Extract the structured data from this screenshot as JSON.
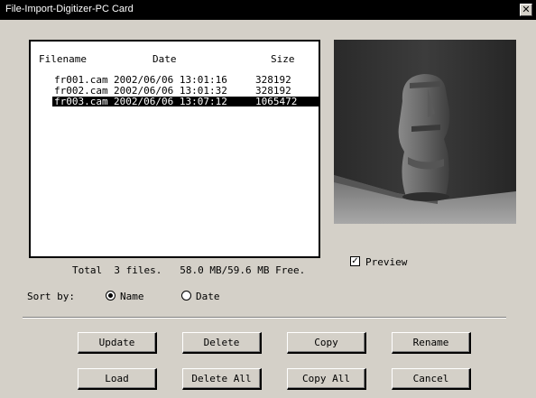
{
  "window": {
    "title": "File-Import-Digitizer-PC Card",
    "close_glyph": "✕"
  },
  "file_list": {
    "columns": [
      "Filename",
      "Date",
      "Size"
    ],
    "rows": [
      {
        "filename": "fr001.cam",
        "date": "2002/06/06 13:01:16",
        "size": "328192",
        "selected": false
      },
      {
        "filename": "fr002.cam",
        "date": "2002/06/06 13:01:32",
        "size": "328192",
        "selected": false
      },
      {
        "filename": "fr003.cam",
        "date": "2002/06/06 13:07:12",
        "size": "1065472",
        "selected": true
      }
    ],
    "status": "Total  3 files.   58.0 MB/59.6 MB Free."
  },
  "preview": {
    "label": "Preview",
    "checked": true,
    "check_glyph": "✓"
  },
  "sort": {
    "label": "Sort by:",
    "options": [
      {
        "label": "Name",
        "checked": true
      },
      {
        "label": "Date",
        "checked": false
      }
    ]
  },
  "buttons": {
    "update": "Update",
    "delete": "Delete",
    "copy": "Copy",
    "rename": "Rename",
    "load": "Load",
    "delete_all": "Delete All",
    "copy_all": "Copy All",
    "cancel": "Cancel"
  }
}
